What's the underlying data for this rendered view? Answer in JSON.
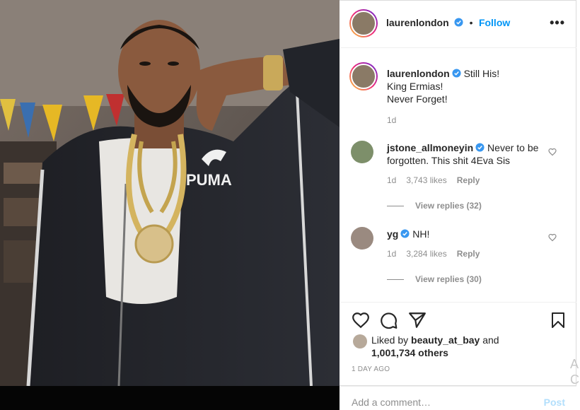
{
  "post": {
    "author": "laurenlondon",
    "follow_label": "Follow",
    "separator": "•",
    "more_label": "•••",
    "caption_lines": [
      "Still His!",
      "King Ermias!",
      "Never Forget!"
    ],
    "caption_age": "1d"
  },
  "comments": [
    {
      "username": "jstone_allmoneyin",
      "verified": true,
      "text": "Never to be forgotten. This shit 4Eva Sis",
      "age": "1d",
      "likes": "3,743 likes",
      "reply_label": "Reply",
      "view_replies": "View replies (32)"
    },
    {
      "username": "yg",
      "verified": true,
      "text": "NH!",
      "age": "1d",
      "likes": "3,284 likes",
      "reply_label": "Reply",
      "view_replies": "View replies (30)"
    }
  ],
  "likes": {
    "prefix": "Liked by",
    "user": "beauty_at_bay",
    "conjunction": "and",
    "others": "1,001,734 others"
  },
  "timestamp": "1 DAY AGO",
  "add_comment": {
    "placeholder": "Add a comment…",
    "post_label": "Post"
  },
  "photo": {
    "brand_text": "PUMA"
  },
  "edge_glyphs": [
    "A",
    "C"
  ],
  "colors": {
    "link_blue": "#0095f6",
    "post_disabled": "#b2dffc",
    "meta_gray": "#8e8e8e",
    "verified_blue": "#3897f0"
  },
  "icons": [
    "heart-icon",
    "comment-icon",
    "share-icon",
    "bookmark-icon",
    "verified-icon",
    "more-icon"
  ]
}
